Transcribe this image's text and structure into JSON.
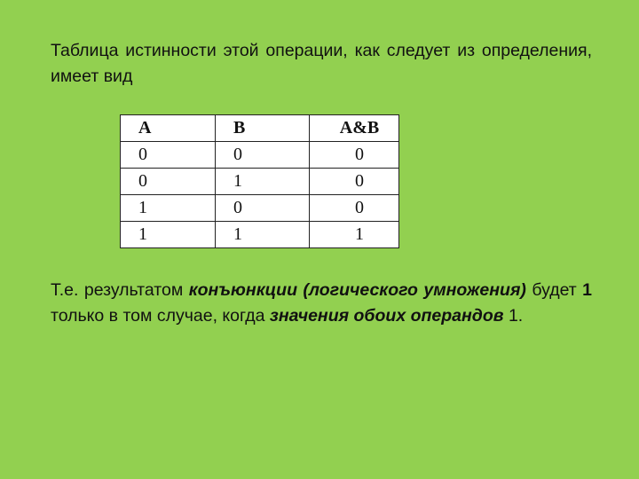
{
  "intro": "Таблица истинности этой операции, как следует из определения, имеет вид",
  "table": {
    "headers": [
      "A",
      "B",
      "A&B"
    ],
    "rows": [
      [
        "0",
        "0",
        "0"
      ],
      [
        "0",
        "1",
        "0"
      ],
      [
        "1",
        "0",
        "0"
      ],
      [
        "1",
        "1",
        "1"
      ]
    ]
  },
  "conclusion": {
    "t1": "Т.е. результатом ",
    "t2": "конъюнкции (логического умножения)",
    "t3": " будет ",
    "t4": "1",
    "t5": " только в том случае, когда ",
    "t6": "значения обоих операндов",
    "t7": " 1."
  }
}
